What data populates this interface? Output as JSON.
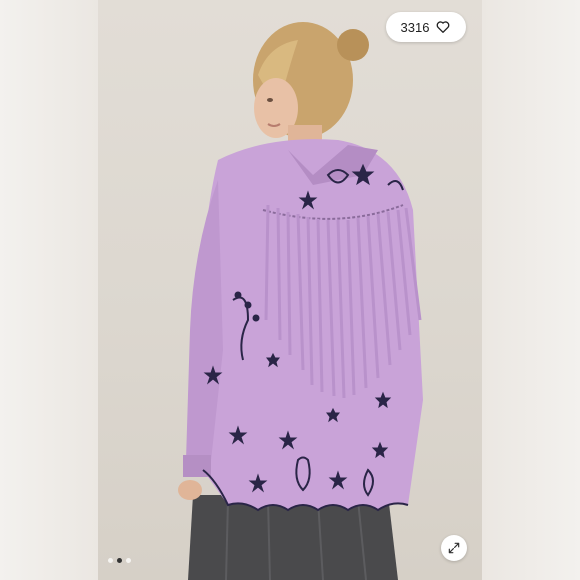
{
  "listing": {
    "like_count": "3316",
    "like_icon": "heart-outline-icon",
    "expand_icon": "expand-arrows-icon",
    "carousel": {
      "total": 3,
      "active_index": 1
    }
  },
  "colors": {
    "jacket": "#c9a3d8",
    "embroidery": "#2a2547",
    "background": "#ddd8d0"
  }
}
